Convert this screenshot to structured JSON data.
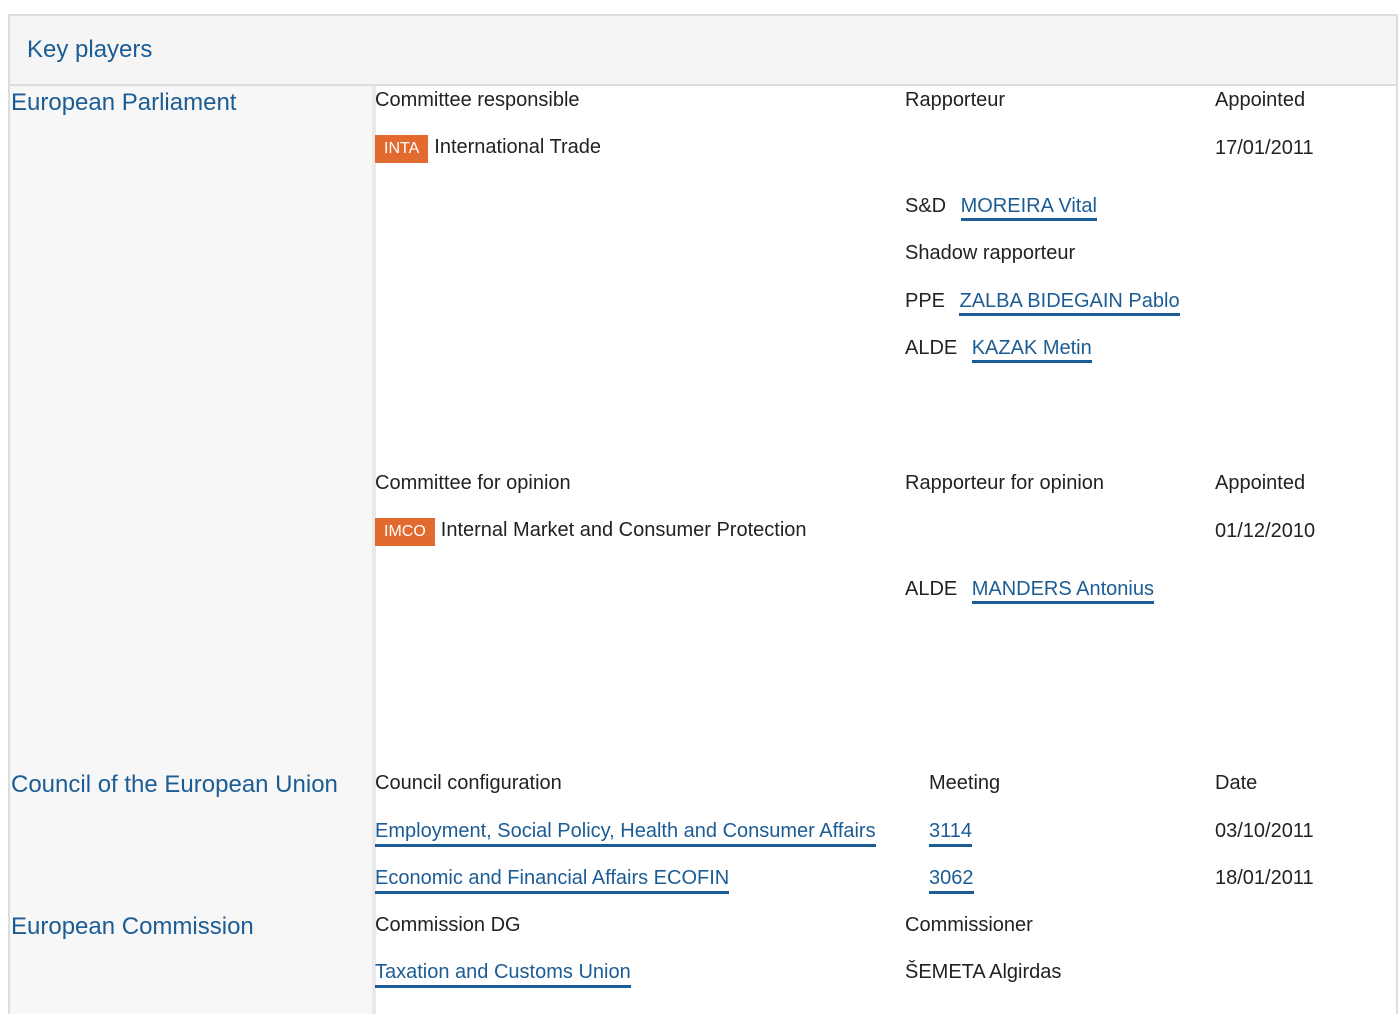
{
  "header": {
    "title": "Key players"
  },
  "ep": {
    "name": "European Parliament",
    "responsible": {
      "col_committee": "Committee responsible",
      "col_rapporteur": "Rapporteur",
      "col_appointed": "Appointed",
      "committee_code": "INTA",
      "committee_name": "International Trade",
      "appointed": "17/01/2011",
      "rapporteur_group": "S&D",
      "rapporteur_name": "MOREIRA Vital",
      "shadow_label": "Shadow rapporteur",
      "shadows": [
        {
          "group": "PPE",
          "name": "ZALBA BIDEGAIN Pablo"
        },
        {
          "group": "ALDE",
          "name": "KAZAK Metin"
        }
      ]
    },
    "opinion": {
      "col_committee": "Committee for opinion",
      "col_rapporteur": "Rapporteur for opinion",
      "col_appointed": "Appointed",
      "committee_code": "IMCO",
      "committee_name": "Internal Market and Consumer Protection",
      "appointed": "01/12/2010",
      "rapporteur_group": "ALDE",
      "rapporteur_name": "MANDERS Antonius"
    }
  },
  "council": {
    "name": "Council of the European Union",
    "col_config": "Council configuration",
    "col_meeting": "Meeting",
    "col_date": "Date",
    "rows": [
      {
        "config": "Employment, Social Policy, Health and Consumer Affairs",
        "meeting": "3114",
        "date": "03/10/2011"
      },
      {
        "config": "Economic and Financial Affairs ECOFIN",
        "meeting": "3062",
        "date": "18/01/2011"
      }
    ]
  },
  "commission": {
    "name": "European Commission",
    "col_dg": "Commission DG",
    "col_commissioner": "Commissioner",
    "dg": "Taxation and Customs Union",
    "commissioner": "ŠEMETA Algirdas"
  },
  "colors": {
    "link": "#1c5c95",
    "badge": "#e36a2e",
    "header_bg": "#f5f5f5"
  }
}
